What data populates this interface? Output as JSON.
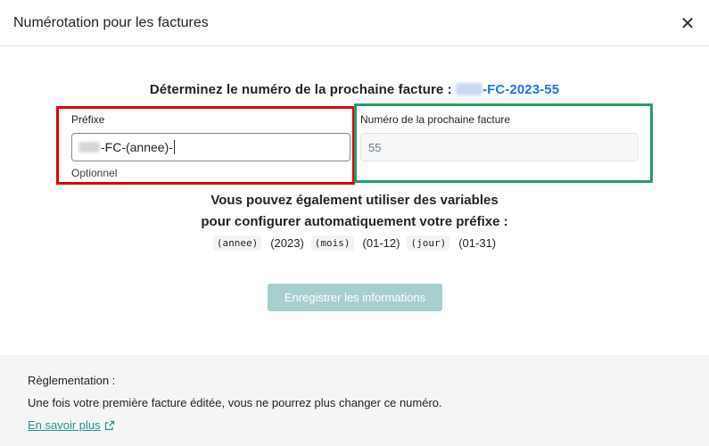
{
  "modal": {
    "title": "Numérotation pour les factures",
    "close_symbol": "✕"
  },
  "heading": {
    "prefix_text": "Déterminez le numéro de la prochaine facture :",
    "number_suffix": "-FC-2023-55"
  },
  "prefix_field": {
    "label": "Préfixe",
    "value_visible": "-FC-(annee)-",
    "help": "Optionnel"
  },
  "next_number_field": {
    "label": "Numéro de la prochaine facture",
    "value": "55"
  },
  "variables": {
    "line1": "Vous pouvez également utiliser des variables",
    "line2": "pour configurer automatiquement votre préfixe :",
    "items": [
      {
        "code": "(annee)",
        "value": "(2023)"
      },
      {
        "code": "(mois)",
        "value": "(01-12)"
      },
      {
        "code": "(jour)",
        "value": "(01-31)"
      }
    ]
  },
  "actions": {
    "save_label": "Enregistrer les informations"
  },
  "footer": {
    "title": "Règlementation :",
    "text": "Une fois votre première facture éditée, vous ne pourrez plus changer ce numéro.",
    "link_label": "En savoir plus"
  },
  "colors": {
    "highlight_red": "#e00000",
    "highlight_green": "#2e9a66",
    "link_blue": "#1a73e8",
    "link_teal": "#2d8f8f",
    "button_disabled": "#a8cfcf"
  },
  "icons": {
    "close": "close-icon",
    "external_link": "external-link-icon"
  }
}
